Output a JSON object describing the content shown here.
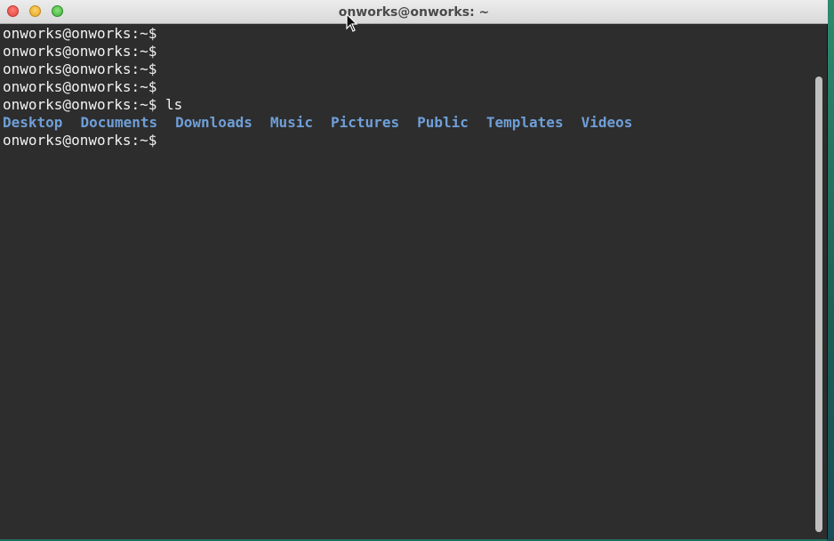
{
  "window": {
    "title": "onworks@onworks: ~"
  },
  "terminal": {
    "lines": [
      {
        "prompt": "onworks@onworks:~$",
        "command": ""
      },
      {
        "prompt": "onworks@onworks:~$",
        "command": ""
      },
      {
        "prompt": "onworks@onworks:~$",
        "command": ""
      },
      {
        "prompt": "onworks@onworks:~$",
        "command": ""
      },
      {
        "prompt": "onworks@onworks:~$",
        "command": " ls"
      }
    ],
    "ls_output": [
      "Desktop",
      "Documents",
      "Downloads",
      "Music",
      "Pictures",
      "Public",
      "Templates",
      "Videos"
    ],
    "final_prompt": "onworks@onworks:~$"
  },
  "colors": {
    "terminal_bg": "#2d2d2d",
    "terminal_fg": "#f2f2f2",
    "directory": "#6f9fd8"
  },
  "icons": {
    "close": "close-button",
    "minimize": "minimize-button",
    "zoom": "zoom-button",
    "cursor": "mouse-pointer-icon"
  }
}
